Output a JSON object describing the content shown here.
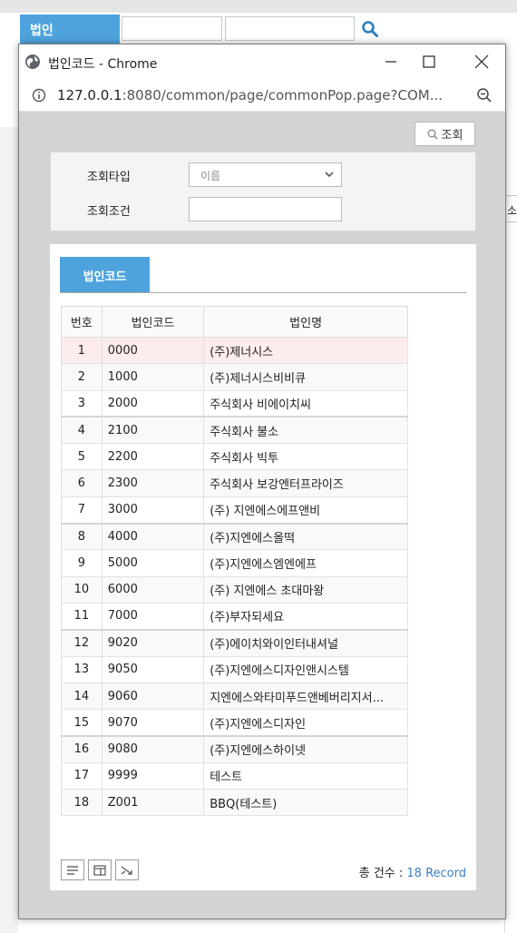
{
  "background": {
    "label": "법인",
    "side_text": "소"
  },
  "window": {
    "title": "법인코드 - Chrome",
    "url_host": "127.0.0.1",
    "url_rest": ":8080/common/page/commonPop.page?COM..."
  },
  "toolbar": {
    "query_label": "조회"
  },
  "conditions": {
    "type_label": "조회타입",
    "type_value": "이름",
    "cond_label": "조회조건",
    "cond_value": ""
  },
  "tab": {
    "label": "법인코드"
  },
  "table": {
    "headers": [
      "번호",
      "법인코드",
      "법인명"
    ],
    "rows": [
      {
        "no": "1",
        "code": "0000",
        "name": "(주)제너시스"
      },
      {
        "no": "2",
        "code": "1000",
        "name": "(주)제너시스비비큐"
      },
      {
        "no": "3",
        "code": "2000",
        "name": "주식회사 비에이치씨"
      },
      {
        "no": "4",
        "code": "2100",
        "name": "주식회사 불소"
      },
      {
        "no": "5",
        "code": "2200",
        "name": "주식회사 빅투"
      },
      {
        "no": "6",
        "code": "2300",
        "name": "주식회사 보강엔터프라이즈"
      },
      {
        "no": "7",
        "code": "3000",
        "name": "(주) 지엔에스에프앤비"
      },
      {
        "no": "8",
        "code": "4000",
        "name": "(주)지엔에스올떡"
      },
      {
        "no": "9",
        "code": "5000",
        "name": "(주)지엔에스엠엔에프"
      },
      {
        "no": "10",
        "code": "6000",
        "name": "(주) 지엔에스 초대마왕"
      },
      {
        "no": "11",
        "code": "7000",
        "name": "(주)부자되세요"
      },
      {
        "no": "12",
        "code": "9020",
        "name": "(주)에이치와이인터내셔널"
      },
      {
        "no": "13",
        "code": "9050",
        "name": "(주)지엔에스디자인앤시스템"
      },
      {
        "no": "14",
        "code": "9060",
        "name": "지엔에스와타미푸드앤베버리지서..."
      },
      {
        "no": "15",
        "code": "9070",
        "name": "(주)지엔에스디자인"
      },
      {
        "no": "16",
        "code": "9080",
        "name": "(주)지엔에스하이넷"
      },
      {
        "no": "17",
        "code": "9999",
        "name": "테스트"
      },
      {
        "no": "18",
        "code": "Z001",
        "name": "BBQ(테스트)"
      }
    ]
  },
  "footer": {
    "total_label": "총 건수 : ",
    "total_count": "18 Record"
  },
  "colors": {
    "accent": "#4ea3dd",
    "selected_row": "#fdecec",
    "count_text": "#3d7ec4"
  }
}
